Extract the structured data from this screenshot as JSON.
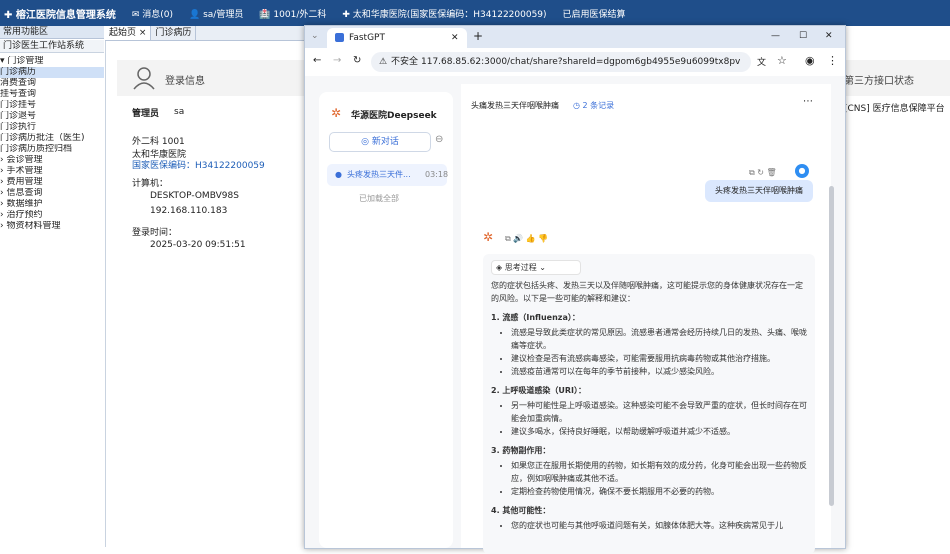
{
  "host": {
    "title": "✚ 榕江医院信息管理系统",
    "top_items": [
      "✉ 消息(0)",
      "👤 sa/管理员",
      "🏥 1001/外二科",
      "✚ 太和华康医院(国家医保编码：H34122200059)",
      "已启用医保结算"
    ],
    "left_title": "常用功能区",
    "left_sub": "门诊医生工作站系统",
    "tree": [
      {
        "label": "▾ 门诊管理",
        "selected": false
      },
      {
        "label": "   门诊病历",
        "selected": true
      },
      {
        "label": "   消费查询",
        "selected": false
      },
      {
        "label": "   挂号查询",
        "selected": false
      },
      {
        "label": "   门诊挂号",
        "selected": false
      },
      {
        "label": "   门诊退号",
        "selected": false
      },
      {
        "label": "   门诊执行",
        "selected": false
      },
      {
        "label": "   门诊病历批注（医生)",
        "selected": false
      },
      {
        "label": "   门诊病历质控归档",
        "selected": false
      },
      {
        "label": "› 会诊管理",
        "selected": false
      },
      {
        "label": "› 手术管理",
        "selected": false
      },
      {
        "label": "› 费用管理",
        "selected": false
      },
      {
        "label": "› 信息查询",
        "selected": false
      },
      {
        "label": "› 数据维护",
        "selected": false
      },
      {
        "label": "› 治疗预约",
        "selected": false
      },
      {
        "label": "› 物资材料管理",
        "selected": false
      }
    ],
    "tabs": [
      "起始页 ×",
      "门诊病历"
    ],
    "login_title": "登录信息",
    "admin_label": "管理员",
    "admin_value": "sa",
    "dept_line": "外二科    1001",
    "hosp_name": "太和华康医院",
    "insurance_code": "国家医保编码：H34122200059",
    "computer_label": "计算机：",
    "computer_name": "DESKTOP-OMBV98S",
    "ip": "192.168.110.183",
    "login_time_label": "登录时间：",
    "login_time": "2025-03-20  09:51:51",
    "right_title": "第三方接口状态",
    "right_item": "[CNS] 医疗信息保障平台"
  },
  "browser": {
    "tab_title": "FastGPT",
    "url_warning": "不安全",
    "url": "117.68.85.62:3000/chat/share?shareId=dgpom6gb4955e9u6099tx8pv",
    "win_min": "—",
    "win_max": "☐",
    "win_close": "✕"
  },
  "chat": {
    "app_name": "华源医院Deepseek",
    "new_chat": "新对话",
    "history_item": "头疼发热三天件...",
    "history_time": "03:18",
    "history_end": "已加载全部",
    "conv_title": "头痛发热三天伴咽喉肿痛",
    "record_count": "2 条记录",
    "user_msg": "头疼发热三天伴咽喉肿痛",
    "think_label": "思考过程",
    "intro": "您的症状包括头疼、发热三天以及伴随咽喉肿痛，这可能提示您的身体健康状况存在一定的风险。以下是一些可能的解释和建议：",
    "sections": [
      {
        "title": "1. 流感（Influenza）：",
        "items": [
          "流感是导致此类症状的常见原因。流感患者通常会经历持续几日的发热、头痛、喉咙痛等症状。",
          "建议检查是否有流感病毒感染，可能需要服用抗病毒药物或其他治疗措施。",
          "流感疫苗通常可以在每年的季节前接种，以减少感染风险。"
        ]
      },
      {
        "title": "2. 上呼吸道感染（URI）：",
        "items": [
          "另一种可能性是上呼吸道感染。这种感染可能不会导致严重的症状，但长时间存在可能会加重病情。",
          "建议多喝水，保持良好睡眠，以帮助缓解呼吸道并减少不适感。"
        ]
      },
      {
        "title": "3. 药物副作用：",
        "items": [
          "如果您正在服用长期使用的药物，如长期有效的成分药，化身可能会出现一些药物反应，例如咽喉肿痛或其他不适。",
          "定期检查药物使用情况，确保不要长期服用不必要的药物。"
        ]
      },
      {
        "title": "4. 其他可能性：",
        "items": [
          "您的症状也可能与其他呼吸道问题有关，如腺体体肥大等。这种疾病常见于儿"
        ]
      }
    ]
  }
}
